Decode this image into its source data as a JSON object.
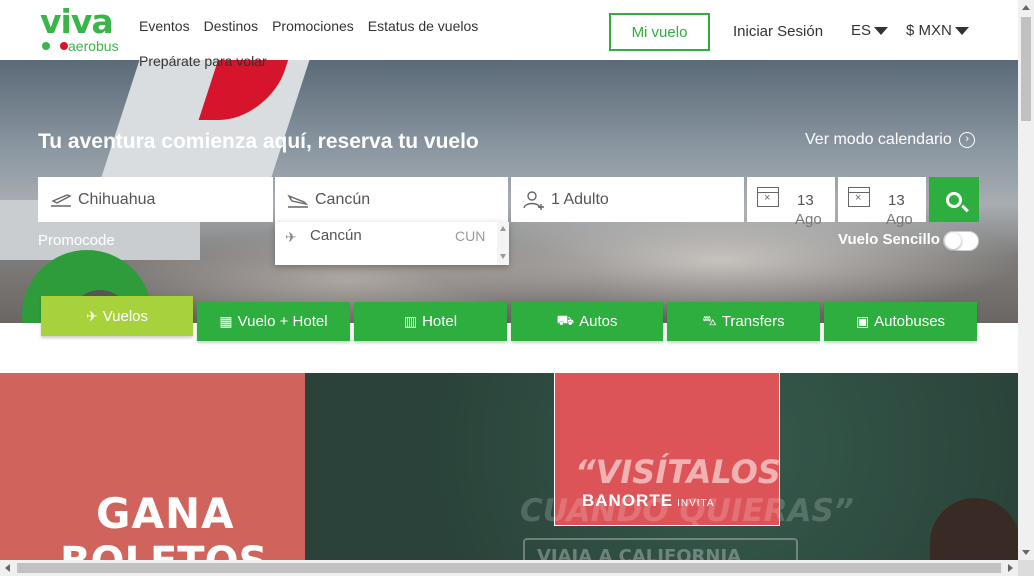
{
  "logo": {
    "brand": "viva",
    "sub": "aerobus"
  },
  "nav": {
    "items": [
      "Eventos",
      "Destinos",
      "Promociones",
      "Estatus de vuelos"
    ],
    "second_row": "Prepárate para volar"
  },
  "header": {
    "mi_vuelo": "Mi vuelo",
    "login": "Iniciar Sesión",
    "language": "ES",
    "currency": "$ MXN"
  },
  "hero": {
    "title": "Tu aventura comienza aquí, reserva tu vuelo",
    "calendar_link": "Ver modo calendario"
  },
  "search": {
    "origin": "Chihuahua",
    "destination": "Cancún",
    "passengers": "1 Adulto",
    "depart_day": "13",
    "depart_month": "Ago",
    "return_day": "13",
    "return_month": "Ago",
    "promocode_label": "Promocode",
    "one_way_label": "Vuelo Sencillo"
  },
  "dropdown": {
    "items": [
      {
        "name": "Cancún",
        "code": "CUN"
      }
    ]
  },
  "tabs": [
    {
      "label": "Vuelos",
      "icon": "plane-icon",
      "active": true
    },
    {
      "label": "Vuelo + Hotel",
      "icon": "building-icon",
      "active": false
    },
    {
      "label": "Hotel",
      "icon": "hotel-icon",
      "active": false
    },
    {
      "label": "Autos",
      "icon": "car-icon",
      "active": false
    },
    {
      "label": "Transfers",
      "icon": "van-icon",
      "active": false
    },
    {
      "label": "Autobuses",
      "icon": "bus-icon",
      "active": false
    }
  ],
  "banner": {
    "left_line1": "GANA",
    "left_line2": "BOLETOS",
    "card_title": "“VISÍTALOS",
    "card_subtitle": "CUANDO QUIERAS”",
    "sponsor": "BANORTE",
    "sponsor_tag": "INVITA",
    "cta": "VIAJA A CALIFORNIA"
  },
  "colors": {
    "brand_green": "#2dae3e",
    "active_tab": "#a7d23b",
    "brand_red": "#d6142c"
  }
}
